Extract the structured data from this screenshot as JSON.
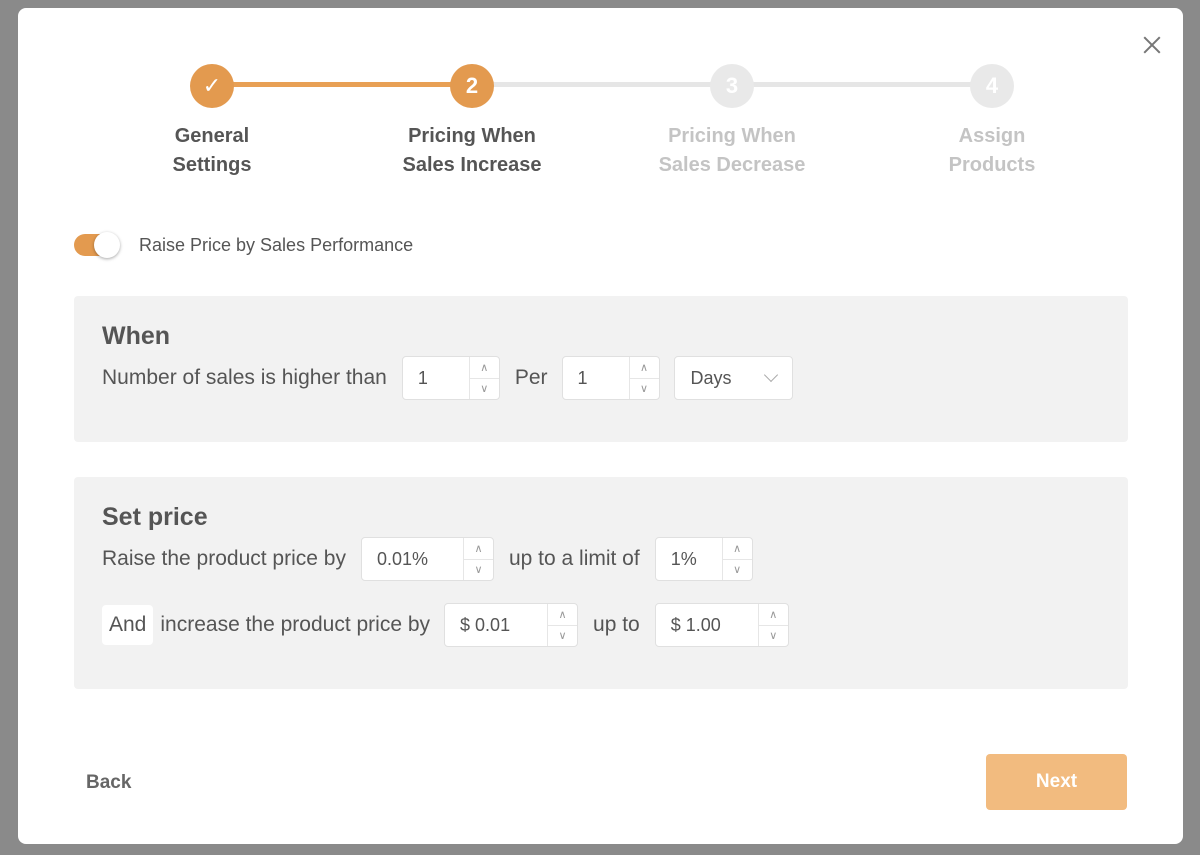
{
  "stepper": {
    "steps": [
      {
        "number": "✓",
        "label": "General\nSettings",
        "state": "done"
      },
      {
        "number": "2",
        "label": "Pricing When\nSales Increase",
        "state": "active"
      },
      {
        "number": "3",
        "label": "Pricing When\nSales Decrease",
        "state": "pending"
      },
      {
        "number": "4",
        "label": "Assign\nProducts",
        "state": "pending"
      }
    ]
  },
  "toggle": {
    "label": "Raise Price by Sales Performance",
    "on": true
  },
  "when": {
    "title": "When",
    "text_1": "Number of sales is higher than",
    "sales_value": "1",
    "text_2": "Per",
    "period_value": "1",
    "period_unit": "Days"
  },
  "set_price": {
    "title": "Set price",
    "row1_text_1": "Raise the product price by",
    "raise_percent": "0.01%",
    "row1_text_2": "up to a limit of",
    "limit_percent": "1%",
    "and_label": "And",
    "row2_text_1": "increase the product price by",
    "increase_amount": "$ 0.01",
    "row2_text_2": "up to",
    "up_to_amount": "$ 1.00"
  },
  "footer": {
    "back_label": "Back",
    "next_label": "Next"
  },
  "colors": {
    "accent": "#e39a4f",
    "next_button": "#f2bb7f",
    "panel_bg": "#f2f2f2"
  }
}
